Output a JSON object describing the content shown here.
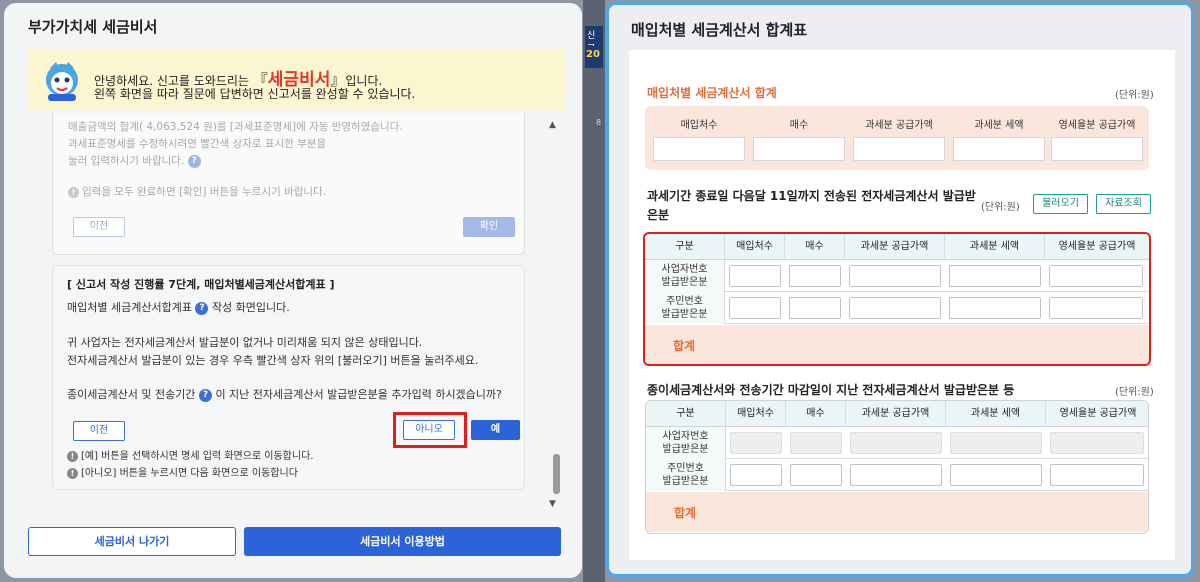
{
  "background": {
    "badge1": "신고",
    "badge2": "20",
    "fragment": "8"
  },
  "left": {
    "title": "부가가치세 세금비서",
    "banner": {
      "pre": "안녕하세요. 신고를 도와드리는 ",
      "open_quote": "『",
      "brand": "세금비서",
      "close_quote": "』",
      "post": "입니다.",
      "line2": "왼쪽 화면을 따라 질문에 답변하면 신고서를 완성할 수 있습니다."
    },
    "box1": {
      "line1": "매출금액의 합계( 4,063,524 원)를 [과세표준명세]에 자동 반영하였습니다.",
      "line2": "과세표준명세를 수정하시려면 빨간색 상자로 표시한 부분을",
      "line3": "눌러 입력하시기 바랍니다.",
      "notice": "입력을 모두 완료하면 [확인] 버튼을 누르시기 바랍니다.",
      "prev_label": "이전",
      "confirm_label": "확인"
    },
    "box2": {
      "heading": "[ 신고서 작성 진행률 7단계, 매입처별세금계산서합계표 ]",
      "line1_pre": "매입처별 세금계산서합계표",
      "line1_post": "작성 화면입니다.",
      "line2": "귀 사업자는 전자세금계산서 발급분이 없거나 미리채움 되지 않은 상태입니다.",
      "line3": "전자세금계산서 발급분이 있는 경우 우측 빨간색 상자 위의 [불러오기] 버튼을 눌러주세요.",
      "question_pre": "종이세금계산서 및 전송기간",
      "question_post": "이 지난 전자세금계산서 발급받은분을 추가입력 하시겠습니까?",
      "prev_label": "이전",
      "no_label": "아니오",
      "yes_label": "예",
      "note1": "[예] 버튼을 선택하시면 명세 입력 화면으로 이동합니다.",
      "note2": "[아니오] 버튼을 누르시면 다음 화면으로 이동합니다"
    },
    "qmark": "?",
    "info": "!",
    "exit_label": "세금비서 나가기",
    "guide_label": "세금비서 이용방법"
  },
  "right": {
    "title": "매입처별 세금계산서 합계표",
    "section1": {
      "title": "매입처별 세금계산서 합계",
      "unit": "(단위:원)",
      "columns": [
        "매입처수",
        "매수",
        "과세분 공급가액",
        "과세분 세액",
        "영세율분 공급가액"
      ]
    },
    "section2": {
      "title": "과세기간 종료일 다음달 11일까지 전송된 전자세금계산서 발급받은분",
      "unit": "(단위:원)",
      "load_label": "불러오기",
      "search_label": "자료조회",
      "columns": [
        "구분",
        "매입처수",
        "매수",
        "과세분 공급가액",
        "과세분 세액",
        "영세율분 공급가액"
      ],
      "rows": [
        {
          "line1": "사업자번호",
          "line2": "발급받은분"
        },
        {
          "line1": "주민번호",
          "line2": "발급받은분"
        }
      ],
      "total": "합계"
    },
    "section3": {
      "title": "종이세금계산서와 전송기간 마감일이 지난 전자세금계산서 발급받은분 등",
      "unit": "(단위:원)",
      "columns": [
        "구분",
        "매입처수",
        "매수",
        "과세분 공급가액",
        "과세분 세액",
        "영세율분 공급가액"
      ],
      "rows": [
        {
          "line1": "사업자번호",
          "line2": "발급받은분"
        },
        {
          "line1": "주민번호",
          "line2": "발급받은분"
        }
      ],
      "total": "합계"
    }
  }
}
